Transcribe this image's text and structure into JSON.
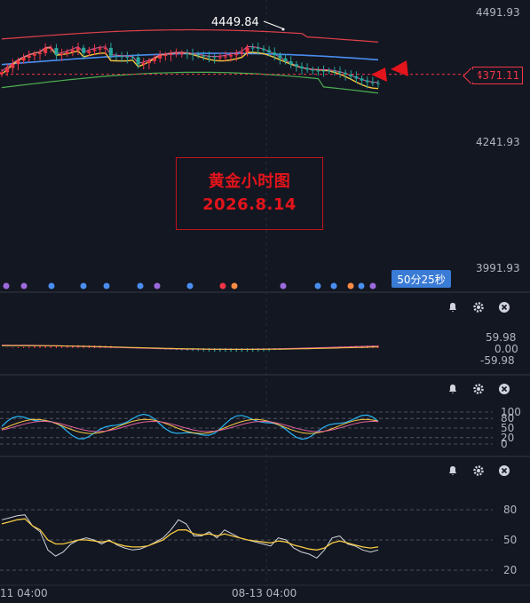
{
  "chart_data": {
    "type": "line",
    "annotation": {
      "line1": "黄金小时图",
      "line2": "2026.8.14"
    },
    "main": {
      "y_axis_ticks": [
        "4491.93",
        "4241.93",
        "3991.93"
      ],
      "high_label": "4449.84",
      "current_price": "4371.11",
      "countdown": "50分25秒"
    },
    "x_axis_labels": [
      "11 04:00",
      "08-13 04:00"
    ],
    "panels": [
      {
        "name": "macd",
        "ticks": [
          "59.98",
          "0.00",
          "-59.98"
        ]
      },
      {
        "name": "kdj",
        "ticks": [
          "100",
          "80",
          "50",
          "20",
          "0"
        ]
      },
      {
        "name": "rsi",
        "ticks": [
          "80",
          "50",
          "20"
        ]
      }
    ],
    "series": {
      "rsi_white": [
        70,
        72,
        74,
        75,
        64,
        58,
        40,
        34,
        38,
        46,
        50,
        52,
        50,
        46,
        50,
        45,
        42,
        40,
        41,
        44,
        48,
        52,
        60,
        70,
        66,
        54,
        54,
        58,
        52,
        60,
        56,
        52,
        50,
        48,
        46,
        44,
        52,
        50,
        42,
        38,
        36,
        32,
        40,
        52,
        54,
        46,
        44,
        40,
        38,
        40
      ],
      "rsi_yellow": [
        66,
        68,
        70,
        71,
        64,
        60,
        50,
        46,
        46,
        48,
        50,
        50,
        49,
        48,
        49,
        46,
        44,
        43,
        43,
        44,
        47,
        50,
        56,
        60,
        60,
        56,
        55,
        56,
        54,
        56,
        54,
        52,
        50,
        49,
        48,
        47,
        49,
        48,
        45,
        43,
        41,
        40,
        42,
        47,
        49,
        47,
        45,
        43,
        42,
        43
      ]
    },
    "colors": {
      "up": "#f23645",
      "down": "#26a69a",
      "boll_upper": "#e0404a",
      "boll_lower": "#4caf50",
      "ma_yellow": "#f5c842",
      "ma_blue": "#4a8ef0",
      "ma_pink": "#e0609c"
    },
    "grid": false
  }
}
